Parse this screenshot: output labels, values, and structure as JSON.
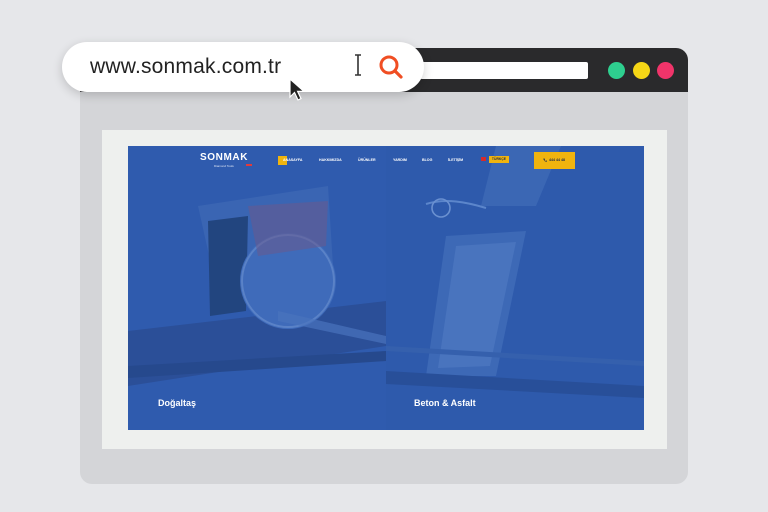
{
  "browser": {
    "url": "www.sonmak.com.tr",
    "window_dots": [
      "#2ecf8f",
      "#f5d616",
      "#f0346a"
    ],
    "search_icon": "search-icon",
    "accent": "#f04e23"
  },
  "site": {
    "logo": "SONMAK",
    "tagline": "Diamond Tools",
    "nav": {
      "items": [
        "ANASAYFA",
        "HAKKIMIZDA",
        "ÜRÜNLER",
        "YARDIM",
        "BLOG",
        "İLETİŞİM"
      ],
      "language": "TÜRKÇE",
      "phone": "444 44 48"
    },
    "panels": [
      {
        "label": "Doğaltaş"
      },
      {
        "label": "Beton & Asfalt"
      }
    ],
    "colors": {
      "overlay_blue": "#2f5bae",
      "accent_yellow": "#f0b40e"
    }
  }
}
